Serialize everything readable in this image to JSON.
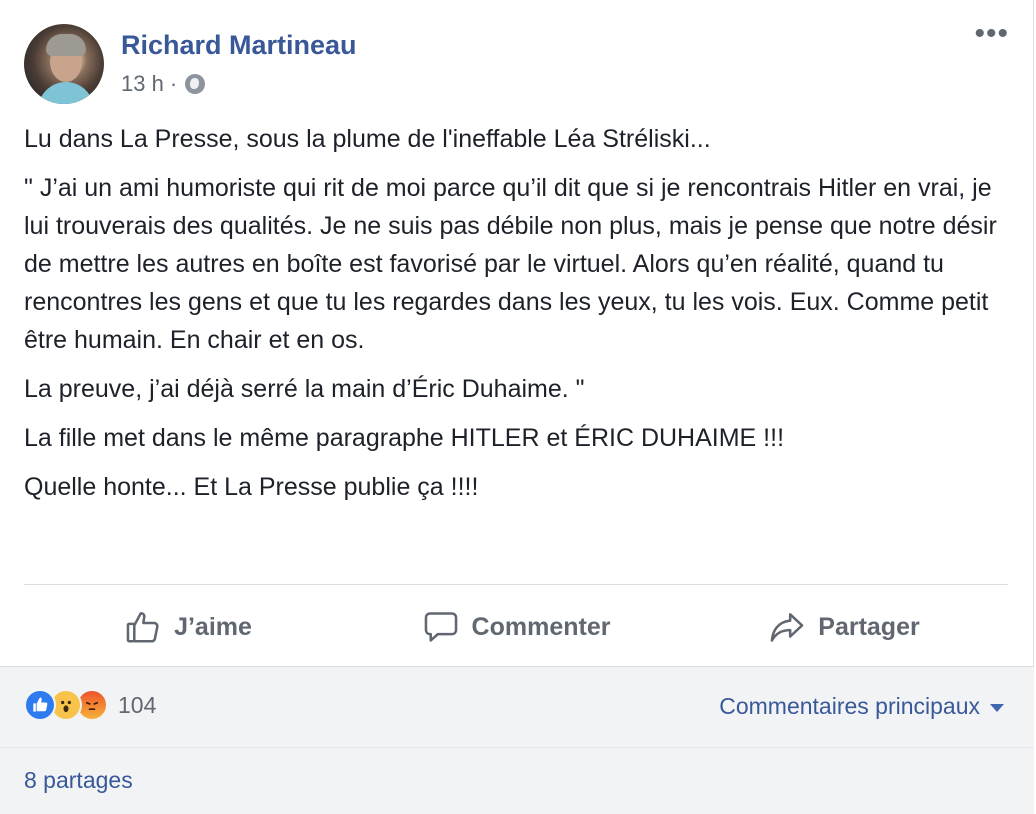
{
  "post": {
    "author": "Richard Martineau",
    "time": "13 h",
    "separator": "·",
    "privacy_icon": "globe-icon",
    "more_icon": "more-icon",
    "paragraphs": [
      "Lu dans La Presse, sous la plume de l'ineffable Léa Stréliski...",
      "\" J’ai un ami humoriste qui rit de moi parce qu’il dit que si je rencontrais Hitler en vrai, je lui trouverais des qualités. Je ne suis pas débile non plus, mais je pense que notre désir de mettre les autres en boîte est favorisé par le virtuel. Alors qu’en réalité, quand tu rencontres les gens et que tu les regardes dans les yeux, tu les vois. Eux. Comme petit être humain. En chair et en os.",
      "La preuve, j’ai déjà serré la main d’Éric Duhaime. \"",
      "La fille met dans le même paragraphe HITLER et ÉRIC DUHAIME !!!",
      "Quelle honte... Et La Presse publie ça !!!!"
    ]
  },
  "actions": {
    "like": "J’aime",
    "comment": "Commenter",
    "share": "Partager"
  },
  "footer": {
    "reactions": [
      "like-icon",
      "wow-icon",
      "angry-icon"
    ],
    "reaction_count": "104",
    "sort_label": "Commentaires principaux",
    "shares": "8 partages"
  },
  "colors": {
    "link": "#385898",
    "muted": "#606770",
    "footer_bg": "#f2f3f5"
  }
}
